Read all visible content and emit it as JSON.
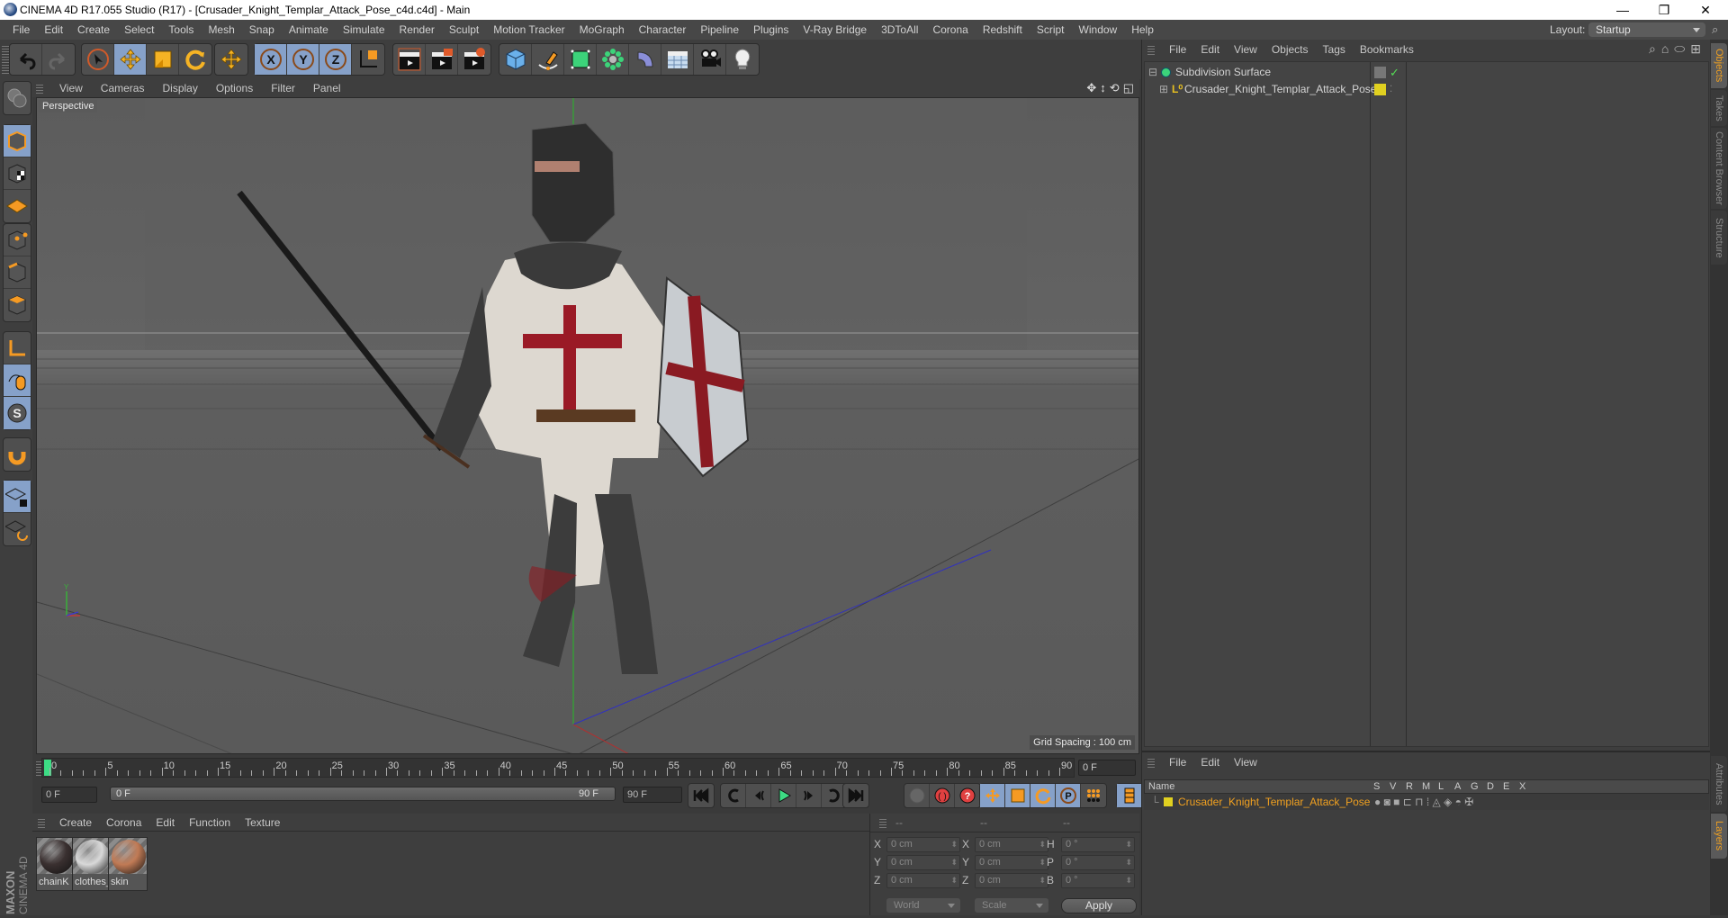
{
  "window": {
    "title": "CINEMA 4D R17.055 Studio (R17) - [Crusader_Knight_Templar_Attack_Pose_c4d.c4d] - Main",
    "minimize": "—",
    "maximize": "❐",
    "close": "✕"
  },
  "menubar": {
    "items": [
      "File",
      "Edit",
      "Create",
      "Select",
      "Tools",
      "Mesh",
      "Snap",
      "Animate",
      "Simulate",
      "Render",
      "Sculpt",
      "Motion Tracker",
      "MoGraph",
      "Character",
      "Pipeline",
      "Plugins",
      "V-Ray Bridge",
      "3DToAll",
      "Corona",
      "Redshift",
      "Script",
      "Window",
      "Help"
    ],
    "layout_label": "Layout:",
    "layout_value": "Startup"
  },
  "toolbar": {
    "icons": [
      "undo-icon",
      "redo-icon",
      "live-selection-icon",
      "move-icon",
      "scale-icon",
      "rotate-icon",
      "transform-icon",
      "x-axis-icon",
      "y-axis-icon",
      "z-axis-icon",
      "coordinate-system-icon",
      "render-view-icon",
      "render-picture-viewer-icon",
      "render-settings-icon",
      "cube-icon",
      "pen-spline-icon",
      "subdivision-icon",
      "cloner-icon",
      "deformer-bend-icon",
      "floor-icon",
      "camera-icon",
      "light-icon"
    ],
    "accent_color": "#f5a623",
    "active_color": "#86a1c9"
  },
  "leftbar": {
    "icons": [
      "make-editable-icon",
      "model-mode-icon",
      "texture-mode-icon",
      "workplane-mode-icon",
      "points-mode-icon",
      "edges-mode-icon",
      "polygons-mode-icon",
      "axis-mode-icon",
      "tweak-mode-icon",
      "solo-icon",
      "snap-magnet-icon",
      "workplane-lock-icon",
      "workplane-align-icon"
    ]
  },
  "viewport": {
    "menu": [
      "View",
      "Cameras",
      "Display",
      "Options",
      "Filter",
      "Panel"
    ],
    "camera_label": "Perspective",
    "grid_spacing": "Grid Spacing : 100 cm",
    "nav_icons": [
      "pan-icon",
      "dolly-icon",
      "orbit-icon",
      "maximize-view-icon"
    ]
  },
  "timeline": {
    "ticks": [
      "0",
      "5",
      "10",
      "15",
      "20",
      "25",
      "30",
      "35",
      "40",
      "45",
      "50",
      "55",
      "60",
      "65",
      "70",
      "75",
      "80",
      "85",
      "90"
    ],
    "current_frame": "0 F",
    "start_field": "0 F",
    "scrub_start": "0 F",
    "scrub_end": "90 F",
    "end_field": "90 F",
    "playhead_color": "#3ddc84"
  },
  "materials": {
    "menu": [
      "Create",
      "Corona",
      "Edit",
      "Function",
      "Texture"
    ],
    "items": [
      {
        "name": "chainK",
        "color": "#3a3030"
      },
      {
        "name": "clothes_",
        "color": "#d8d8d8"
      },
      {
        "name": "skin",
        "color": "#c07a55"
      }
    ]
  },
  "branding": {
    "maxon": "MAXON",
    "product": "CINEMA 4D"
  },
  "coordinates": {
    "headers": [
      "--",
      "--",
      "--"
    ],
    "rows": [
      {
        "l1": "X",
        "v1": "0 cm",
        "l2": "X",
        "v2": "0 cm",
        "l3": "H",
        "v3": "0 °"
      },
      {
        "l1": "Y",
        "v1": "0 cm",
        "l2": "Y",
        "v2": "0 cm",
        "l3": "P",
        "v3": "0 °"
      },
      {
        "l1": "Z",
        "v1": "0 cm",
        "l2": "Z",
        "v2": "0 cm",
        "l3": "B",
        "v3": "0 °"
      }
    ],
    "space": "World",
    "mode": "Scale",
    "apply": "Apply"
  },
  "objects": {
    "menu": [
      "File",
      "Edit",
      "View",
      "Objects",
      "Tags",
      "Bookmarks"
    ],
    "items": [
      {
        "name": "Subdivision Surface",
        "expander": "⊟",
        "check": "✓"
      },
      {
        "name": "Crusader_Knight_Templar_Attack_Pose",
        "expander": "⊞",
        "layer_color": "#e0d020"
      }
    ]
  },
  "layers": {
    "menu": [
      "File",
      "Edit",
      "View"
    ],
    "columns": [
      "Name",
      "S",
      "V",
      "R",
      "M",
      "L",
      "A",
      "G",
      "D",
      "E",
      "X"
    ],
    "items": [
      {
        "name": "Crusader_Knight_Templar_Attack_Pose",
        "color": "#e0d020"
      }
    ]
  },
  "right_tabs": {
    "top": [
      "Objects",
      "Takes",
      "Content Browser",
      "Structure"
    ],
    "bottom": [
      "Attributes",
      "Layers"
    ]
  }
}
